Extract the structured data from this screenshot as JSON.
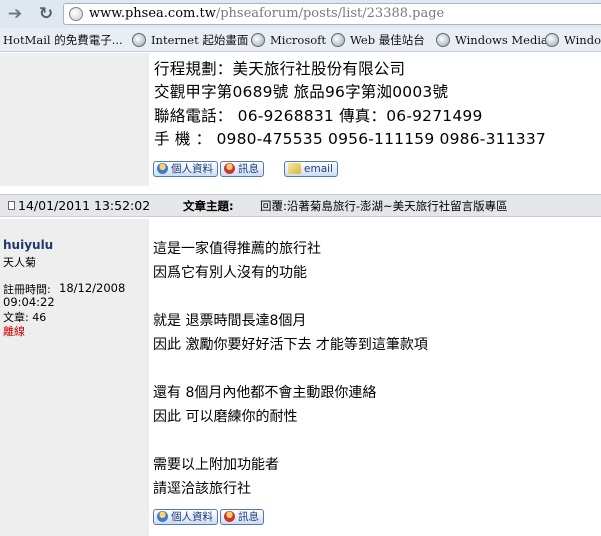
{
  "browser": {
    "url_domain": "www.phsea.com.tw",
    "url_path": "/phseaforum/posts/list/23388.page",
    "bookmarks": [
      {
        "label": "HotMail 的免費電子..."
      },
      {
        "label": "Internet 起始畫面"
      },
      {
        "label": "Microsoft"
      },
      {
        "label": "Web 最佳站台"
      },
      {
        "label": "Windows Media"
      },
      {
        "label": "Windows"
      }
    ]
  },
  "prev_post": {
    "signature": [
      "行程規劃：美天旅行社股份有限公司",
      "交觀甲字第0689號 旅品96字第洳0003號",
      "聯絡電話： 06-9268831 傳真：06-9271499",
      "手 機 ： 0980-475535 0956-111159 0986-311337"
    ],
    "buttons": {
      "profile": "個人資料",
      "pm": "訊息",
      "email": "email"
    }
  },
  "post": {
    "date": "14/01/2011 13:52:02",
    "subject_label": "文章主題:",
    "subject": "回覆:沿著菊島旅行-澎湖~美天旅行社留言版專區",
    "author": {
      "name": "huiyulu",
      "title": "天人菊",
      "reg_label": "註冊時間:",
      "reg_date": "18/12/2008",
      "reg_time": "09:04:22",
      "posts": "文章: 46",
      "status": "離線"
    },
    "body": [
      "這是一家值得推薦的旅行社",
      "因爲它有別人沒有的功能",
      "",
      "就是 退票時間長達8個月",
      "因此 激勵你要好好活下去 才能等到這筆款項",
      "",
      "還有 8個月內他都不會主動跟你連絡",
      "因此 可以磨練你的耐性",
      "",
      "需要以上附加功能者",
      "請逕洽該旅行社"
    ],
    "buttons": {
      "profile": "個人資料",
      "pm": "訊息"
    }
  }
}
